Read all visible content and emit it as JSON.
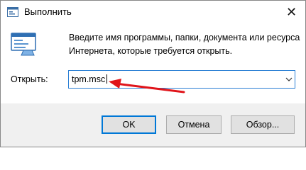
{
  "window": {
    "title": "Выполнить",
    "close_glyph": "✕"
  },
  "dialog": {
    "description_lines": [
      "Введите имя программы, папки, документа или ресурса",
      "Интернета, которые требуется открыть."
    ],
    "open_label": "Открыть:",
    "open_value": "tpm.msc"
  },
  "buttons": {
    "ok": "OK",
    "cancel": "Отмена",
    "browse": "Обзор..."
  },
  "icons": {
    "app": "run-app-icon",
    "dialog": "run-dialog-icon",
    "close": "close-icon",
    "dropdown": "chevron-down-icon",
    "annotation": "red-arrow-annotation"
  },
  "colors": {
    "focus_border": "#2a7fd4",
    "default_button_border": "#0078d7",
    "footer_background": "#f0f0f0",
    "annotation_arrow": "#e0141a"
  }
}
